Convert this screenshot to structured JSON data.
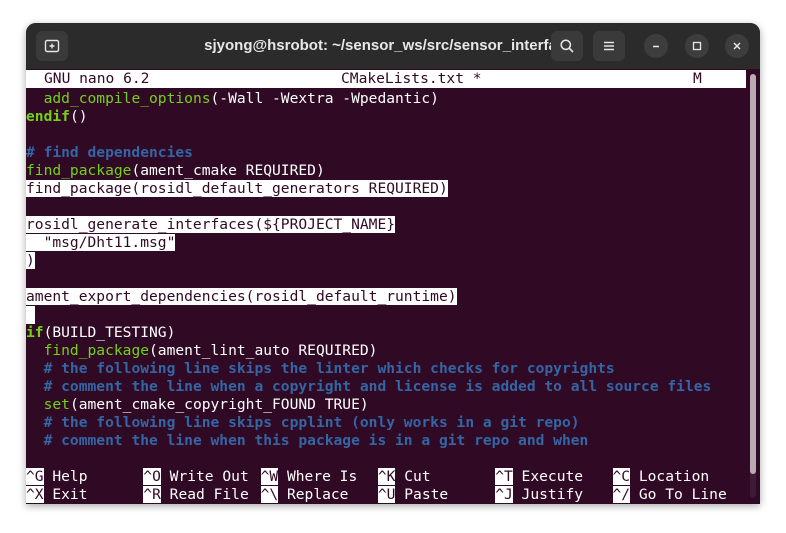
{
  "window": {
    "title": "sjyong@hsrobot: ~/sensor_ws/src/sensor_interfaces"
  },
  "titlebar_icons": {
    "new_tab": "new-tab-icon",
    "search": "search-icon",
    "menu": "hamburger-menu-icon",
    "minimize": "minimize-icon",
    "maximize": "maximize-icon",
    "close": "close-icon"
  },
  "nano": {
    "version": "GNU nano 6.2",
    "filename": "CMakeLists.txt *",
    "modified": "M"
  },
  "code_lines": [
    {
      "segments": [
        {
          "t": "  "
        },
        {
          "t": "add_compile_options",
          "c": "fn"
        },
        {
          "t": "(-Wall -Wextra -Wpedantic)"
        }
      ]
    },
    {
      "segments": [
        {
          "t": "endif",
          "c": "kw"
        },
        {
          "t": "()"
        }
      ]
    },
    {
      "segments": []
    },
    {
      "segments": [
        {
          "t": "# find dependencies",
          "c": "cm"
        }
      ]
    },
    {
      "segments": [
        {
          "t": "find_package",
          "c": "fn"
        },
        {
          "t": "(ament_cmake REQUIRED)"
        }
      ]
    },
    {
      "segments": [
        {
          "t": "find_package(rosidl_default_generators REQUIRED)",
          "c": "hl"
        }
      ]
    },
    {
      "segments": []
    },
    {
      "segments": [
        {
          "t": "rosidl_generate_interfaces(${PROJECT_NAME}",
          "c": "hl"
        }
      ]
    },
    {
      "segments": [
        {
          "t": "  \"msg/Dht11.msg\"",
          "c": "hl"
        }
      ]
    },
    {
      "segments": [
        {
          "t": ")",
          "c": "hl"
        }
      ]
    },
    {
      "segments": []
    },
    {
      "segments": [
        {
          "t": "ament_export_dependencies(rosidl_default_runtime)",
          "c": "hl"
        }
      ]
    },
    {
      "segments": [
        {
          "t": "",
          "c": "cursor"
        }
      ]
    },
    {
      "segments": [
        {
          "t": "if",
          "c": "kw"
        },
        {
          "t": "(BUILD_TESTING)"
        }
      ]
    },
    {
      "segments": [
        {
          "t": "  "
        },
        {
          "t": "find_package",
          "c": "fn"
        },
        {
          "t": "(ament_lint_auto REQUIRED)"
        }
      ]
    },
    {
      "segments": [
        {
          "t": "  "
        },
        {
          "t": "# the following line skips the linter which checks for copyrights",
          "c": "cm"
        }
      ]
    },
    {
      "segments": [
        {
          "t": "  "
        },
        {
          "t": "# comment the line when a copyright and license is added to all source files",
          "c": "cm"
        }
      ]
    },
    {
      "segments": [
        {
          "t": "  "
        },
        {
          "t": "set",
          "c": "fn"
        },
        {
          "t": "(ament_cmake_copyright_FOUND TRUE)"
        }
      ]
    },
    {
      "segments": [
        {
          "t": "  "
        },
        {
          "t": "# the following line skips cpplint (only works in a git repo)",
          "c": "cm"
        }
      ]
    },
    {
      "segments": [
        {
          "t": "  "
        },
        {
          "t": "# comment the line when this package is in a git repo and when",
          "c": "cm"
        }
      ]
    }
  ],
  "help": {
    "row1": [
      {
        "key": "^G",
        "label": " Help"
      },
      {
        "key": "^O",
        "label": " Write Out"
      },
      {
        "key": "^W",
        "label": " Where Is"
      },
      {
        "key": "^K",
        "label": " Cut"
      },
      {
        "key": "^T",
        "label": " Execute"
      },
      {
        "key": "^C",
        "label": " Location"
      }
    ],
    "row2": [
      {
        "key": "^X",
        "label": " Exit"
      },
      {
        "key": "^R",
        "label": " Read File"
      },
      {
        "key": "^\\",
        "label": " Replace"
      },
      {
        "key": "^U",
        "label": " Paste"
      },
      {
        "key": "^J",
        "label": " Justify"
      },
      {
        "key": "^/",
        "label": " Go To Line"
      }
    ]
  }
}
